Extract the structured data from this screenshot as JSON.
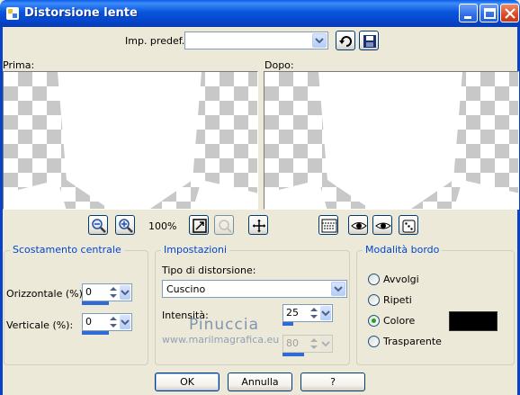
{
  "window": {
    "title": "Distorsione lente",
    "controls": [
      "minimize-icon",
      "maximize-icon",
      "close-icon"
    ]
  },
  "preset": {
    "label": "Imp. predef.:",
    "value": ""
  },
  "previews": {
    "before_label": "Prima:",
    "after_label": "Dopo:"
  },
  "zoom": {
    "level": "100%"
  },
  "center_offset": {
    "title": "Scostamento centrale",
    "horizontal_label": "Orizzontale (%):",
    "horizontal_value": "0",
    "vertical_label": "Verticale (%):",
    "vertical_value": "0"
  },
  "settings": {
    "title": "Impostazioni",
    "distortion_type_label": "Tipo di distorsione:",
    "distortion_type_value": "Cuscino",
    "intensity_label": "Intensità:",
    "intensity_value": "25",
    "second_value": "80"
  },
  "edge_mode": {
    "title": "Modalità bordo",
    "options": [
      "Avvolgi",
      "Ripeti",
      "Colore",
      "Trasparente"
    ],
    "selected": "Colore",
    "color": "#000000"
  },
  "buttons": {
    "ok": "OK",
    "cancel": "Annulla",
    "help": "?"
  },
  "watermark": {
    "line1": "Pinuccia",
    "line2": "www.marilmagrafica.eu"
  },
  "colors": {
    "titlebar": "#0a55e0",
    "group_title": "#0046d5",
    "background": "#ece9d8"
  }
}
